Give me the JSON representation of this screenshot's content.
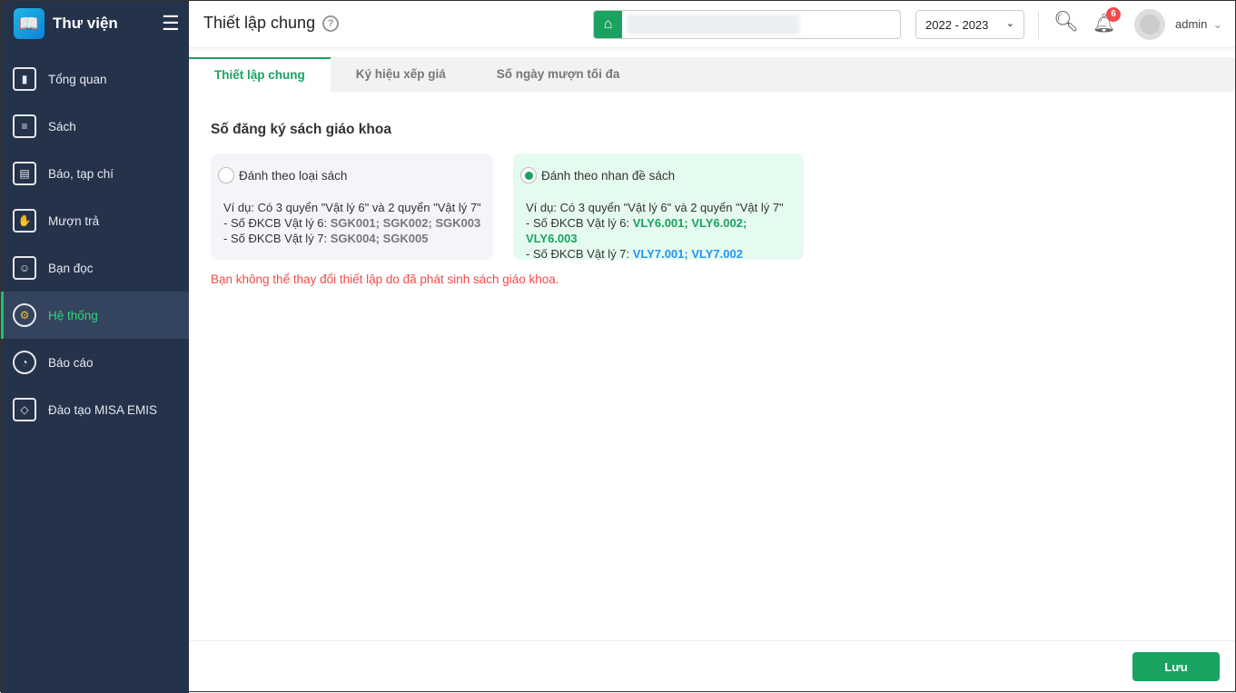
{
  "app": {
    "name": "Thư viện"
  },
  "sidebar": {
    "items": [
      {
        "label": "Tổng quan",
        "icon": "chart-bars"
      },
      {
        "label": "Sách",
        "icon": "book"
      },
      {
        "label": "Báo, tạp chí",
        "icon": "newspaper"
      },
      {
        "label": "Mượn trả",
        "icon": "borrow"
      },
      {
        "label": "Bạn đọc",
        "icon": "reader"
      },
      {
        "label": "Hệ thống",
        "icon": "gear"
      },
      {
        "label": "Báo cáo",
        "icon": "pie"
      },
      {
        "label": "Đào tạo MISA EMIS",
        "icon": "cube"
      }
    ],
    "active": "Hệ thống"
  },
  "header": {
    "title": "Thiết lập chung",
    "year": "2022 - 2023",
    "notifications": "6",
    "user": "admin"
  },
  "tabs": [
    "Thiết lập chung",
    "Ký hiệu xếp giá",
    "Số ngày mượn tối đa"
  ],
  "section_title": "Số đăng ký sách giáo khoa",
  "options": [
    {
      "label": "Đánh theo loại sách",
      "selected": false,
      "example": "Ví dụ: Có 3 quyển \"Vật lý 6\" và 2 quyển \"Vật lý 7\"",
      "line1_prefix": "- Số ĐKCB Vật lý 6: ",
      "line1_codes": "SGK001; SGK002; SGK003",
      "line2_prefix": "- Số ĐKCB Vật lý 7: ",
      "line2_codes": "SGK004; SGK005"
    },
    {
      "label": "Đánh theo nhan đề sách",
      "selected": true,
      "example": "Ví dụ: Có 3 quyển \"Vật lý 6\" và 2 quyển \"Vật lý 7\"",
      "line1_prefix": "- Số ĐKCB Vật lý 6: ",
      "line1_codes": "VLY6.001; VLY6.002; VLY6.003",
      "line2_prefix": "- Số ĐKCB Vật lý 7: ",
      "line2_codes": "VLY7.001; VLY7.002"
    }
  ],
  "warning": "Bạn không thể thay đổi thiết lập do đã phát sinh sách giáo khoa.",
  "footer": {
    "save_label": "Lưu"
  },
  "colors": {
    "accent": "#1aa260",
    "sidebar": "#24324a",
    "warning": "#f04b4b",
    "blue": "#2196f3"
  }
}
